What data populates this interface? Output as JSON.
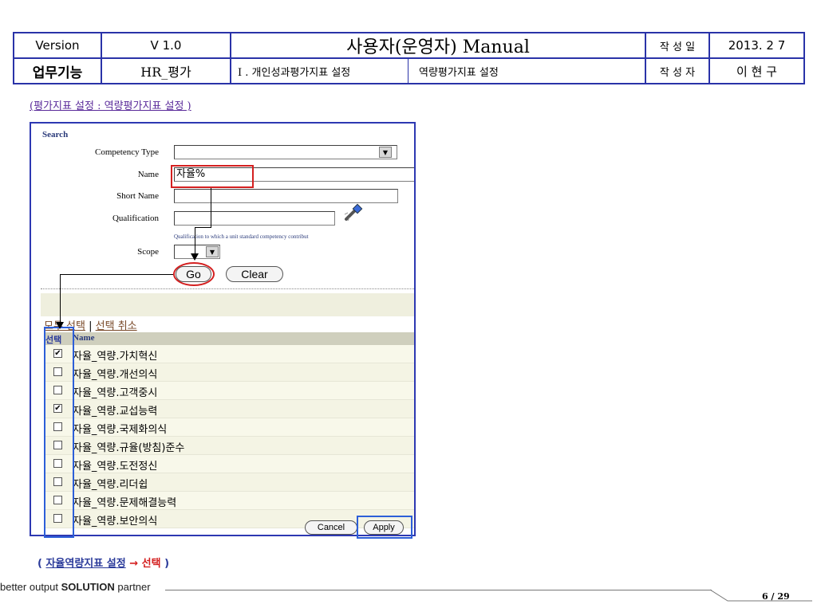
{
  "header": {
    "version_label": "Version",
    "version_value": "V 1.0",
    "title": "사용자(운영자) Manual",
    "date_label": "작 성 일",
    "date_value": "2013. 2 7",
    "function_label": "업무기능",
    "function_value": "HR_평가",
    "section": "I . 개인성과평가지표 설정",
    "subsection": "역량평가지표 설정",
    "author_label": "작 성 자",
    "author_value": "이 현 구"
  },
  "caption": "(평가지표 설정 : 역량평가지표 설정 )",
  "search": {
    "title": "Search",
    "fields": {
      "competency_type_label": "Competency Type",
      "competency_type_value": "",
      "name_label": "Name",
      "name_value": "자율%",
      "short_name_label": "Short Name",
      "short_name_value": "",
      "qualification_label": "Qualification",
      "qualification_value": "",
      "qualification_hint": "Qualification to which a unit standard competency contribut",
      "scope_label": "Scope",
      "scope_value": ""
    },
    "go_label": "Go",
    "clear_label": "Clear"
  },
  "selection": {
    "select_all": "모두 선택",
    "separator": "|",
    "deselect_all": "선택 취소"
  },
  "table": {
    "col_select": "선택",
    "col_name": "Name",
    "rows": [
      {
        "name": "자율_역량.가치혁신",
        "checked": true
      },
      {
        "name": "자율_역량.개선의식",
        "checked": false
      },
      {
        "name": "자율_역량.고객중시",
        "checked": false
      },
      {
        "name": "자율_역량.교섭능력",
        "checked": true
      },
      {
        "name": "자율_역량.국제화의식",
        "checked": false
      },
      {
        "name": "자율_역량.규율(방침)준수",
        "checked": false
      },
      {
        "name": "자율_역량.도전정신",
        "checked": false
      },
      {
        "name": "자율_역량.리더쉽",
        "checked": false
      },
      {
        "name": "자율_역량.문제해결능력",
        "checked": false
      },
      {
        "name": "자율_역량.보안의식",
        "checked": false
      }
    ]
  },
  "buttons": {
    "cancel_label": "Cancel",
    "apply_label": "Apply"
  },
  "footer": {
    "note_prefix": "( ",
    "note_link": "자율역량지표 설정",
    "note_arrow": "→",
    "note_select": "선택",
    "note_suffix": " )",
    "brand_prefix": "better output ",
    "brand_bold": "SOLUTION",
    "brand_suffix": " partner",
    "page_number": "6 / 29"
  },
  "colors": {
    "frame_blue": "#2a33a8",
    "highlight_red": "#d42020",
    "highlight_blue": "#2d5fd8"
  }
}
